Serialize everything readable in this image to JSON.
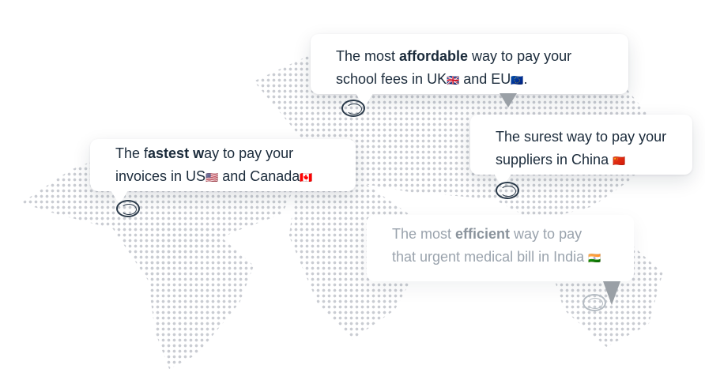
{
  "map": {
    "name": "world-dot-map"
  },
  "cards": {
    "uk": {
      "line1_pre": "The most ",
      "line1_bold": "affordable",
      "line1_post": " way to pay your",
      "line2_pre": "school fees in UK",
      "flag1": "🇬🇧",
      "line2_mid": " and EU",
      "flag2": "🇪🇺",
      "line2_post": "."
    },
    "us": {
      "line1_pre": "The f",
      "line1_bold": "astest w",
      "line1_post": "ay to pay your",
      "line2_pre": "invoices in US",
      "flag1": "🇺🇸",
      "line2_mid": " and Canada",
      "flag2": "🇨🇦"
    },
    "china": {
      "line1": "The surest way to pay your",
      "line2_pre": "suppliers in China ",
      "flag1": "🇨🇳"
    },
    "india": {
      "line1_pre": "The most ",
      "line1_bold": "efficient",
      "line1_post": " way to pay",
      "line2_pre": "that urgent medical bill in India ",
      "flag1": "🇮🇳"
    }
  }
}
